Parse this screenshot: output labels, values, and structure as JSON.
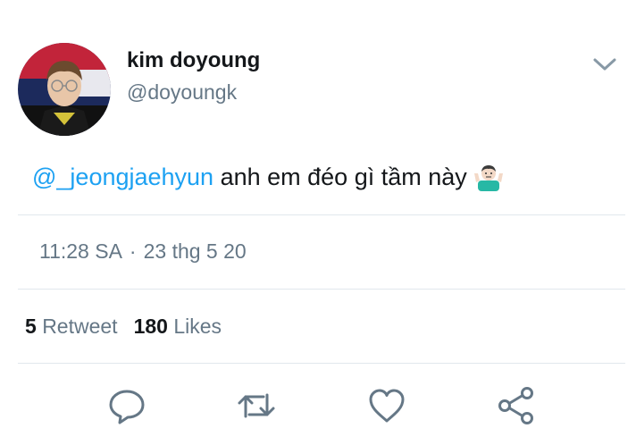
{
  "tweet": {
    "author": {
      "display_name": "kim doyoung",
      "handle": "@doyoungk"
    },
    "mention": "@_jeongjaehyun",
    "text": " anh em đéo gì tầm này",
    "emoji": "shrug-emoji",
    "time": "11:28 SA",
    "separator": "·",
    "date": "23 thg 5 20",
    "retweet_count": "5",
    "retweet_label": "Retweet",
    "like_count": "180",
    "like_label": "Likes"
  },
  "actions": [
    "reply-icon",
    "retweet-icon",
    "like-icon",
    "share-icon"
  ],
  "colors": {
    "link": "#1da1f2",
    "secondary_text": "#657786",
    "divider": "#e1e8ed",
    "icon": "#657786"
  }
}
